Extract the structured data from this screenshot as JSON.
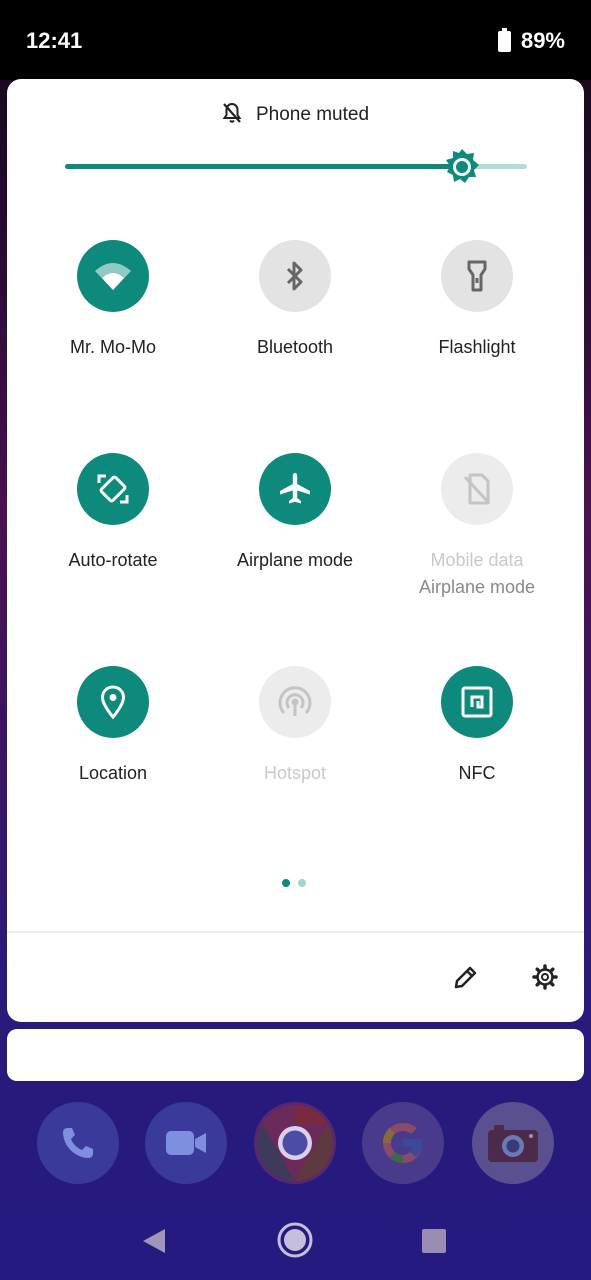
{
  "status_bar": {
    "time": "12:41",
    "battery": "89%"
  },
  "quick_settings": {
    "mute_text": "Phone muted",
    "brightness_level": 0.86,
    "tiles": [
      {
        "label": "Mr. Mo-Mo",
        "icon": "wifi-icon",
        "state": "on"
      },
      {
        "label": "Bluetooth",
        "icon": "bluetooth-icon",
        "state": "off"
      },
      {
        "label": "Flashlight",
        "icon": "flashlight-icon",
        "state": "off"
      },
      {
        "label": "Auto-rotate",
        "icon": "auto-rotate-icon",
        "state": "on"
      },
      {
        "label": "Airplane mode",
        "icon": "airplane-icon",
        "state": "on"
      },
      {
        "label": "Mobile data",
        "sublabel": "Airplane mode",
        "icon": "mobile-data-off-icon",
        "state": "disabled"
      },
      {
        "label": "Location",
        "icon": "location-icon",
        "state": "on"
      },
      {
        "label": "Hotspot",
        "icon": "hotspot-icon",
        "state": "disabled"
      },
      {
        "label": "NFC",
        "icon": "nfc-icon",
        "state": "on"
      }
    ],
    "page_count": 2,
    "current_page": 1
  },
  "dock": [
    {
      "icon": "phone-app-icon"
    },
    {
      "icon": "duo-video-app-icon"
    },
    {
      "icon": "chrome-app-icon"
    },
    {
      "icon": "google-app-icon"
    },
    {
      "icon": "camera-app-icon"
    }
  ],
  "colors": {
    "accent": "#0d8a7b",
    "tile_off": "#e3e3e3",
    "panel": "#ffffff"
  }
}
